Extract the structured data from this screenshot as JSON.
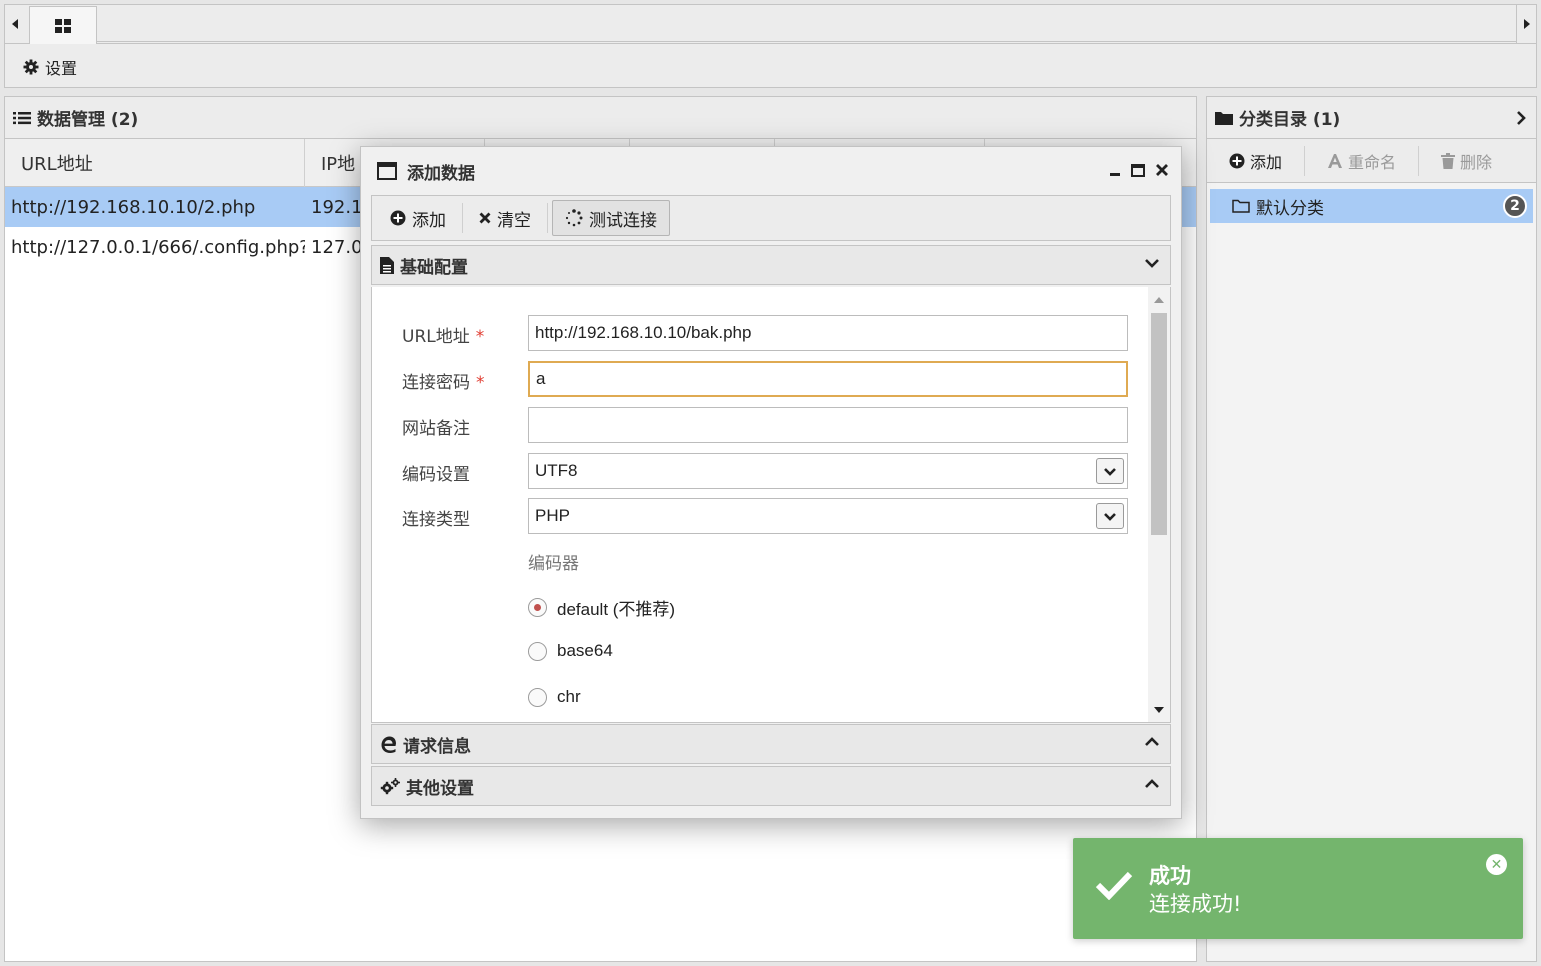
{
  "toolbar": {
    "settings_label": "设置"
  },
  "data_panel": {
    "title": "数据管理 (2)",
    "columns": [
      "URL地址",
      "IP地"
    ],
    "rows": [
      {
        "url": "http://192.168.10.10/2.php",
        "ip": "192.1"
      },
      {
        "url": "http://127.0.0.1/666/.config.php?|",
        "ip": "127.0"
      }
    ]
  },
  "category_panel": {
    "title": "分类目录 (1)",
    "add_label": "添加",
    "rename_label": "重命名",
    "delete_label": "删除",
    "items": [
      {
        "label": "默认分类",
        "count": "2"
      }
    ]
  },
  "modal": {
    "title": "添加数据",
    "toolbar": {
      "add_label": "添加",
      "clear_label": "清空",
      "test_label": "测试连接"
    },
    "sections": {
      "basic": "基础配置",
      "request": "请求信息",
      "other": "其他设置"
    },
    "form": {
      "url_label": "URL地址",
      "url_value": "http://192.168.10.10/bak.php",
      "password_label": "连接密码",
      "password_value": "a",
      "note_label": "网站备注",
      "note_value": "",
      "encoding_label": "编码设置",
      "encoding_value": "UTF8",
      "type_label": "连接类型",
      "type_value": "PHP",
      "required_mark": "*",
      "encoder_title": "编码器",
      "encoders": [
        {
          "label": "default (不推荐)",
          "checked": true
        },
        {
          "label": "base64",
          "checked": false
        },
        {
          "label": "chr",
          "checked": false
        }
      ]
    }
  },
  "toast": {
    "title": "成功",
    "message": "连接成功!",
    "color": "#74b56d"
  }
}
